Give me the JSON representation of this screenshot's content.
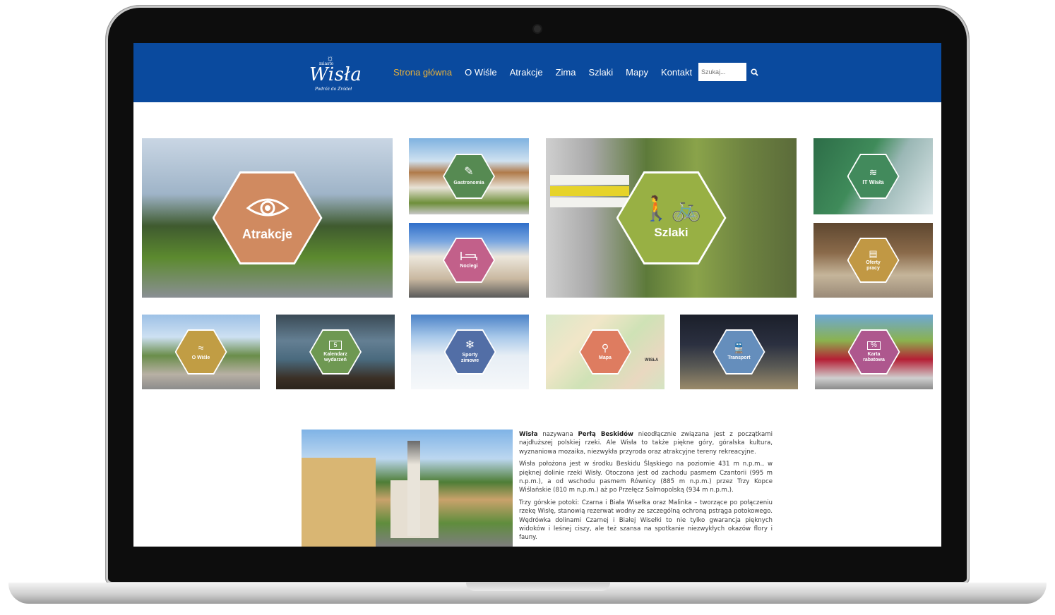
{
  "header": {
    "logo": {
      "small": "miasto",
      "name": "Wisła",
      "tagline": "Podróż do Źródeł"
    },
    "nav": [
      "Strona główna",
      "O Wiśle",
      "Atrakcje",
      "Zima",
      "Szlaki",
      "Mapy",
      "Kontakt"
    ],
    "search": {
      "placeholder": "Szukaj..."
    }
  },
  "colors": {
    "header_bg": "#0a4a9e",
    "nav_active": "#e8b13a"
  },
  "tiles": [
    {
      "label": "Atrakcje",
      "icon": "eye-icon",
      "color": "#c97a4a"
    },
    {
      "label": "Gastronomia",
      "icon": "cutlery-icon",
      "color": "#3f7a3a"
    },
    {
      "label": "Noclegi",
      "icon": "bed-icon",
      "color": "#b94a7a"
    },
    {
      "label": "Szlaki",
      "icon": "hiker-bike-icon",
      "color": "#8aa52a"
    },
    {
      "label": "IT Wisła",
      "icon": "it-logo-icon",
      "color": "#2e7d4a"
    },
    {
      "label": "Oferty pracy",
      "icon": "document-icon",
      "color": "#b88a2a"
    },
    {
      "label": "O Wiśle",
      "icon": "wisla-logo-icon",
      "color": "#b8902a"
    },
    {
      "label": "Kalendarz wydarzeń",
      "icon": "calendar-icon",
      "color": "#5a8a3a"
    },
    {
      "label": "Sporty zimowe",
      "icon": "snowflake-icon",
      "color": "#3a5a9a"
    },
    {
      "label": "Mapa",
      "icon": "map-icon",
      "color": "#d96a4a"
    },
    {
      "label": "Transport",
      "icon": "train-icon",
      "color": "#4a7ab0"
    },
    {
      "label": "Karta rabatowa",
      "icon": "percent-icon",
      "color": "#a03a7a"
    }
  ],
  "calendar_day": "5",
  "intro": {
    "p1_b1": "Wisła",
    "p1_t1": " nazywana ",
    "p1_b2": "Perłą Beskidów",
    "p1_t2": " nieodłącznie związana jest z początkami najdłuższej polskiej rzeki. Ale Wisła to także piękne góry, góralska kultura, wyznaniowa mozaika, niezwykła przyroda oraz atrakcyjne tereny rekreacyjne.",
    "p2": "Wisła położona jest w środku Beskidu Śląskiego na poziomie 431 m n.p.m., w pięknej dolinie rzeki Wisły. Otoczona jest od zachodu pasmem Czantorii (995 m n.p.m.), a od wschodu pasmem Równicy (885 m n.p.m.) przez Trzy Kopce Wiślańskie (810 m n.p.m.) aż po Przełęcz Salmopolską (934 m n.p.m.).",
    "p3": "Trzy górskie potoki: Czarna i Biała Wisełka oraz Malinka – tworzące po połączeniu rzekę Wisłę, stanowią rezerwat wodny ze szczególną ochroną pstrąga potokowego. Wędrówka dolinami Czarnej i Białej Wisełki to nie tylko gwarancja pięknych widoków i leśnej ciszy, ale też szansa na spotkanie niezwykłych okazów flory i fauny."
  },
  "map_label": "WISŁA"
}
